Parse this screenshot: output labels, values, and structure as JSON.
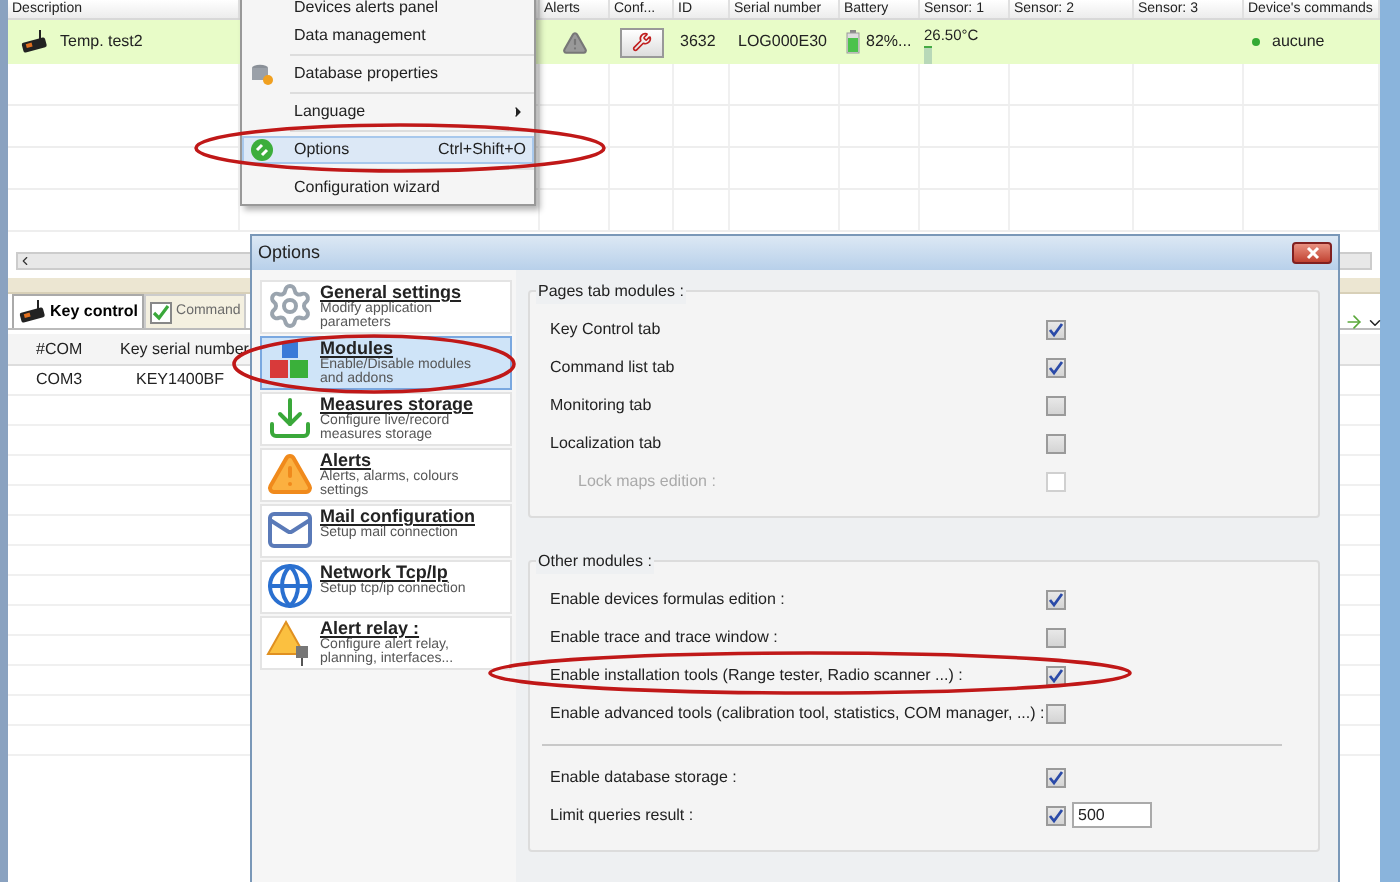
{
  "table": {
    "columns": [
      "Description",
      "Alerts",
      "Conf...",
      "ID",
      "Serial number",
      "Battery",
      "Sensor: 1",
      "Sensor: 2",
      "Sensor: 3",
      "Device's commands"
    ],
    "rows": [
      {
        "description": "Temp. test2",
        "id": "3632",
        "serial": "LOG000E30",
        "battery": "82%...",
        "sensor_1": "26.50°C",
        "command": "aucune",
        "selected": true
      }
    ]
  },
  "menu": {
    "items": [
      {
        "label": "Devices alerts panel",
        "kind": "plain",
        "submenu": false,
        "selected": false
      },
      {
        "label": "Data management",
        "kind": "plain",
        "submenu": false,
        "selected": false
      },
      {
        "kind": "separator"
      },
      {
        "label": "Database properties",
        "kind": "database",
        "submenu": false,
        "selected": false
      },
      {
        "kind": "separator"
      },
      {
        "label": "Language",
        "kind": "plain",
        "submenu": true,
        "selected": false
      },
      {
        "kind": "separator"
      },
      {
        "label": "Options",
        "kind": "options",
        "shortcut": "Ctrl+Shift+O",
        "submenu": false,
        "selected": true
      },
      {
        "kind": "separator"
      },
      {
        "label": "Configuration wizard",
        "kind": "plain",
        "submenu": false,
        "selected": false
      }
    ]
  },
  "bottom_panel": {
    "tabs": [
      {
        "label": "Key control",
        "kind": "key",
        "selected": true
      },
      {
        "label": "Command",
        "kind": "command",
        "selected": false
      }
    ],
    "columns": [
      "#COM",
      "Key serial number"
    ],
    "rows": [
      [
        "COM3",
        "KEY1400BF"
      ]
    ]
  },
  "dialog": {
    "title": "Options",
    "nav": [
      {
        "title": "General settings",
        "description": "Modify application parameters",
        "kind": "gears",
        "selected": false
      },
      {
        "title": "Modules",
        "description": "Enable/Disable modules and addons",
        "kind": "blocks",
        "selected": true
      },
      {
        "title": "Measures storage",
        "description": "Configure live/record measures storage",
        "kind": "download",
        "selected": false
      },
      {
        "title": "Alerts",
        "description": "Alerts, alarms, colours settings",
        "kind": "warning",
        "selected": false
      },
      {
        "title": "Mail configuration",
        "description": "Setup mail connection",
        "kind": "mail",
        "selected": false
      },
      {
        "title": "Network Tcp/Ip",
        "description": "Setup tcp/ip connection",
        "kind": "globe",
        "selected": false
      },
      {
        "title": "Alert relay :",
        "description": "Configure alert relay, planning, interfaces...",
        "kind": "relay",
        "selected": false
      }
    ],
    "groups": [
      {
        "title": "Pages tab modules :",
        "options": [
          {
            "kind": "checkbox",
            "label": "Key Control tab",
            "checked": true,
            "disabled": false
          },
          {
            "kind": "checkbox",
            "label": "Command list tab",
            "checked": true,
            "disabled": false
          },
          {
            "kind": "checkbox",
            "label": "Monitoring tab",
            "checked": false,
            "disabled": false
          },
          {
            "kind": "checkbox",
            "label": "Localization tab",
            "checked": false,
            "disabled": false
          },
          {
            "kind": "checkbox",
            "label": "Lock maps edition :",
            "checked": false,
            "disabled": true
          }
        ]
      },
      {
        "title": "Other modules :",
        "options": [
          {
            "kind": "checkbox",
            "label": "Enable devices formulas edition :",
            "checked": true,
            "disabled": false
          },
          {
            "kind": "checkbox",
            "label": "Enable trace and trace window :",
            "checked": false,
            "disabled": false
          },
          {
            "kind": "checkbox",
            "label": "Enable installation tools (Range tester, Radio scanner ...) :",
            "checked": true,
            "disabled": false
          },
          {
            "kind": "checkbox",
            "label": "Enable advanced tools (calibration tool, statistics, COM manager, ...) :",
            "checked": false,
            "disabled": false
          },
          {
            "kind": "separator"
          },
          {
            "kind": "checkbox",
            "label": "Enable database storage :",
            "checked": true,
            "disabled": false
          },
          {
            "kind": "field",
            "label": "Limit queries result :",
            "checked": true,
            "disabled": false,
            "value": "500"
          }
        ]
      }
    ]
  }
}
